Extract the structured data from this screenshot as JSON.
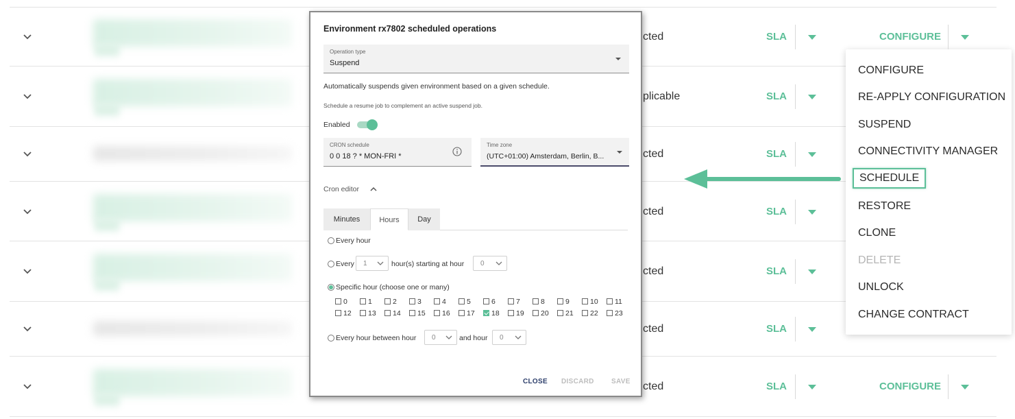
{
  "table": {
    "rows": [
      {
        "status": "cted",
        "sla": "SLA",
        "configure": "CONFIGURE",
        "blur": "green"
      },
      {
        "status": "plicable",
        "sla": "SLA",
        "configure": "",
        "blur": "green"
      },
      {
        "status": "cted",
        "sla": "SLA",
        "configure": "",
        "blur": "gray"
      },
      {
        "status": "cted",
        "sla": "SLA",
        "configure": "",
        "blur": "green"
      },
      {
        "status": "cted",
        "sla": "SLA",
        "configure": "",
        "blur": "green"
      },
      {
        "status": "cted",
        "sla": "SLA",
        "configure": "",
        "blur": "gray"
      },
      {
        "status": "cted",
        "sla": "SLA",
        "configure": "CONFIGURE",
        "blur": "green"
      }
    ]
  },
  "menu": {
    "items": [
      {
        "label": "CONFIGURE",
        "disabled": false
      },
      {
        "label": "RE-APPLY CONFIGURATION",
        "disabled": false
      },
      {
        "label": "SUSPEND",
        "disabled": false
      },
      {
        "label": "CONNECTIVITY MANAGER",
        "disabled": false
      },
      {
        "label": "SCHEDULE",
        "disabled": false,
        "highlighted": true
      },
      {
        "label": "RESTORE",
        "disabled": false
      },
      {
        "label": "CLONE",
        "disabled": false
      },
      {
        "label": "DELETE",
        "disabled": true
      },
      {
        "label": "UNLOCK",
        "disabled": false
      },
      {
        "label": "CHANGE CONTRACT",
        "disabled": false
      }
    ]
  },
  "dialog": {
    "title": "Environment rx7802 scheduled operations",
    "operation_type": {
      "label": "Operation type",
      "value": "Suspend"
    },
    "description": "Automatically suspends given environment based on a given schedule.",
    "hint": "Schedule a resume job to complement an active suspend job.",
    "enabled_label": "Enabled",
    "enabled": true,
    "cron": {
      "label": "CRON schedule",
      "value": "0 0 18 ? * MON-FRI *"
    },
    "timezone": {
      "label": "Time zone",
      "value": "(UTC+01:00) Amsterdam, Berlin, B..."
    },
    "cron_editor_label": "Cron editor",
    "tabs": [
      {
        "label": "Minutes",
        "active": false
      },
      {
        "label": "Hours",
        "active": true
      },
      {
        "label": "Day",
        "active": false
      }
    ],
    "options": {
      "every_hour": "Every hour",
      "every_prefix": "Every",
      "every_value": "1",
      "every_middle": "hour(s) starting at hour",
      "every_start": "0",
      "specific": "Specific hour (choose one or many)",
      "between_prefix": "Every hour between hour",
      "between_from": "0",
      "between_mid": "and hour",
      "between_to": "0"
    },
    "hours": [
      "0",
      "1",
      "2",
      "3",
      "4",
      "5",
      "6",
      "7",
      "8",
      "9",
      "10",
      "11",
      "12",
      "13",
      "14",
      "15",
      "16",
      "17",
      "18",
      "19",
      "20",
      "21",
      "22",
      "23"
    ],
    "checked_hours": [
      "18"
    ],
    "buttons": {
      "close": "CLOSE",
      "discard": "DISCARD",
      "save": "SAVE"
    }
  },
  "colors": {
    "accent": "#5cbf98",
    "disabled": "#b5b5b5"
  }
}
